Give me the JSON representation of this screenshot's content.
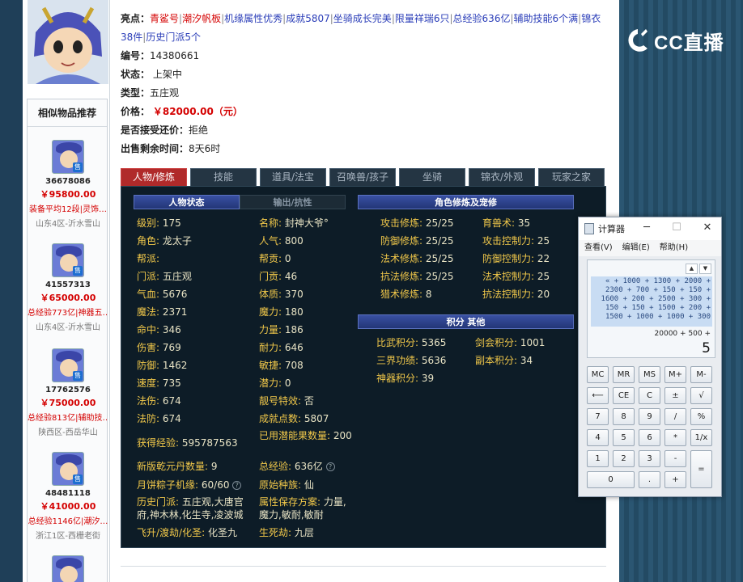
{
  "item": {
    "highlights_label": "亮点：",
    "highlights": [
      {
        "text": "青鲨号",
        "color": "red"
      },
      {
        "text": "潮汐帆板",
        "color": "red"
      },
      {
        "text": "机缘属性优秀",
        "color": "blue"
      },
      {
        "text": "成就5807",
        "color": "blue"
      },
      {
        "text": "坐骑成长完美",
        "color": "blue"
      },
      {
        "text": "限量祥瑞6只",
        "color": "blue"
      },
      {
        "text": "总经验636亿",
        "color": "blue"
      },
      {
        "text": "辅助技能6个满",
        "color": "blue"
      },
      {
        "text": "锦衣38件",
        "color": "blue"
      },
      {
        "text": "历史门派5个",
        "color": "blue"
      }
    ],
    "number_label": "编号：",
    "number": "14380661",
    "status_label": "状态：",
    "status": "上架中",
    "type_label": "类型：",
    "type": "五庄观",
    "price_label": "价格：",
    "price": "￥82000.00（元）",
    "bargain_label": "是否接受还价：",
    "bargain": "拒绝",
    "remaining_label": "出售剩余时间：",
    "remaining": "8天6时"
  },
  "similar": {
    "title": "相似物品推荐",
    "items": [
      {
        "id": "36678086",
        "price": "￥95800.00",
        "desc": "装备平均12段|灵饰…",
        "server": "山东4区-沂水雪山"
      },
      {
        "id": "41557313",
        "price": "￥65000.00",
        "desc": "总经验773亿|神器五…",
        "server": "山东4区-沂水雪山"
      },
      {
        "id": "17762576",
        "price": "￥75000.00",
        "desc": "总经验813亿|辅助技…",
        "server": "陕西区-西岳华山"
      },
      {
        "id": "48481118",
        "price": "￥41000.00",
        "desc": "总经验1146亿|潮汐…",
        "server": "浙江1区-西栅老街"
      }
    ],
    "thumb_tag": "售"
  },
  "tabs": [
    "人物/修炼",
    "技能",
    "道具/法宝",
    "召唤兽/孩子",
    "坐骑",
    "锦衣/外观",
    "玩家之家"
  ],
  "panel": {
    "sect_status": "人物状态",
    "sect_resist": "输出/抗性",
    "sect_cultivation": "角色修炼及宠修",
    "sect_points": "积分 其他",
    "left_rows": [
      {
        "k": "级别:",
        "v": "175"
      },
      {
        "k": "角色:",
        "v": "龙太子"
      },
      {
        "k": "帮派:",
        "v": ""
      },
      {
        "k": "门派:",
        "v": "五庄观"
      },
      {
        "k": "气血:",
        "v": "5676"
      },
      {
        "k": "魔法:",
        "v": "2371"
      },
      {
        "k": "命中:",
        "v": "346"
      },
      {
        "k": "伤害:",
        "v": "769"
      },
      {
        "k": "防御:",
        "v": "1462"
      },
      {
        "k": "速度:",
        "v": "735"
      },
      {
        "k": "法伤:",
        "v": "674"
      },
      {
        "k": "法防:",
        "v": "674"
      }
    ],
    "right_rows": [
      {
        "k": "名称:",
        "v": "封神大爷°"
      },
      {
        "k": "人气:",
        "v": "800"
      },
      {
        "k": "帮贡:",
        "v": "0"
      },
      {
        "k": "门贡:",
        "v": "46"
      },
      {
        "k": "体质:",
        "v": "370"
      },
      {
        "k": "魔力:",
        "v": "180"
      },
      {
        "k": "力量:",
        "v": "186"
      },
      {
        "k": "耐力:",
        "v": "646"
      },
      {
        "k": "敏捷:",
        "v": "708"
      },
      {
        "k": "潜力:",
        "v": "0"
      },
      {
        "k": "靓号特效:",
        "v": "否"
      },
      {
        "k": "成就点数:",
        "v": "5807"
      }
    ],
    "exp": {
      "k": "获得经验:",
      "v": "595787563"
    },
    "potential_used": {
      "k": "已用潜能果数量:",
      "v": "200"
    },
    "qianyuan": {
      "k": "新版乾元丹数量:",
      "v": "9"
    },
    "total_exp": {
      "k": "总经验:",
      "v": "636亿"
    },
    "zongzi": {
      "k": "月饼粽子机缘:",
      "v": "60/60"
    },
    "origin_race": {
      "k": "原始种族:",
      "v": "仙"
    },
    "history_sects": {
      "k": "历史门派:",
      "v": "五庄观,大唐官府,神木林,化生寺,凌波城"
    },
    "attr_plans": {
      "k": "属性保存方案:",
      "v": "力量,魔力,敏耐,敏耐"
    },
    "feisheng": {
      "k": "飞升/渡劫/化圣:",
      "v": "化圣九"
    },
    "shengsi": {
      "k": "生死劫:",
      "v": "九层"
    },
    "cultivation_left": [
      {
        "k": "攻击修炼:",
        "v": "25/25"
      },
      {
        "k": "防御修炼:",
        "v": "25/25"
      },
      {
        "k": "法术修炼:",
        "v": "25/25"
      },
      {
        "k": "抗法修炼:",
        "v": "25/25"
      },
      {
        "k": "猎术修炼:",
        "v": "8"
      }
    ],
    "cultivation_right": [
      {
        "k": "育兽术:",
        "v": "35"
      },
      {
        "k": "攻击控制力:",
        "v": "25"
      },
      {
        "k": "防御控制力:",
        "v": "22"
      },
      {
        "k": "法术控制力:",
        "v": "25"
      },
      {
        "k": "抗法控制力:",
        "v": "20"
      }
    ],
    "points": [
      {
        "k": "比武积分:",
        "v": "5365"
      },
      {
        "k": "剑会积分:",
        "v": "1001"
      },
      {
        "k": "三界功绩:",
        "v": "5636"
      },
      {
        "k": "副本积分:",
        "v": "34"
      },
      {
        "k": "神器积分:",
        "v": "39"
      }
    ],
    "qmark": "?"
  },
  "watermark": {
    "text": "CC直播"
  },
  "calculator": {
    "title": "计算器",
    "menu": [
      "查看(V)",
      "编辑(E)",
      "帮助(H)"
    ],
    "history": [
      "« + 1000 + 1300 + 2000 +",
      "2300 + 700 + 150 + 150 +",
      "1600 + 200 + 2500 + 300 +",
      "150 + 150 + 1500 + 200 +",
      "1500 + 1000 + 1000 + 300"
    ],
    "expression": "20000 + 500 +",
    "result": "5",
    "spin_up": "▲",
    "spin_down": "▼",
    "buttons": [
      [
        "MC",
        "MR",
        "MS",
        "M+",
        "M-"
      ],
      [
        "⟵",
        "CE",
        "C",
        "±",
        "√"
      ],
      [
        "7",
        "8",
        "9",
        "/",
        "%"
      ],
      [
        "4",
        "5",
        "6",
        "*",
        "1/x"
      ],
      [
        "1",
        "2",
        "3",
        "-",
        "="
      ],
      [
        "0",
        ".",
        "+"
      ]
    ]
  }
}
